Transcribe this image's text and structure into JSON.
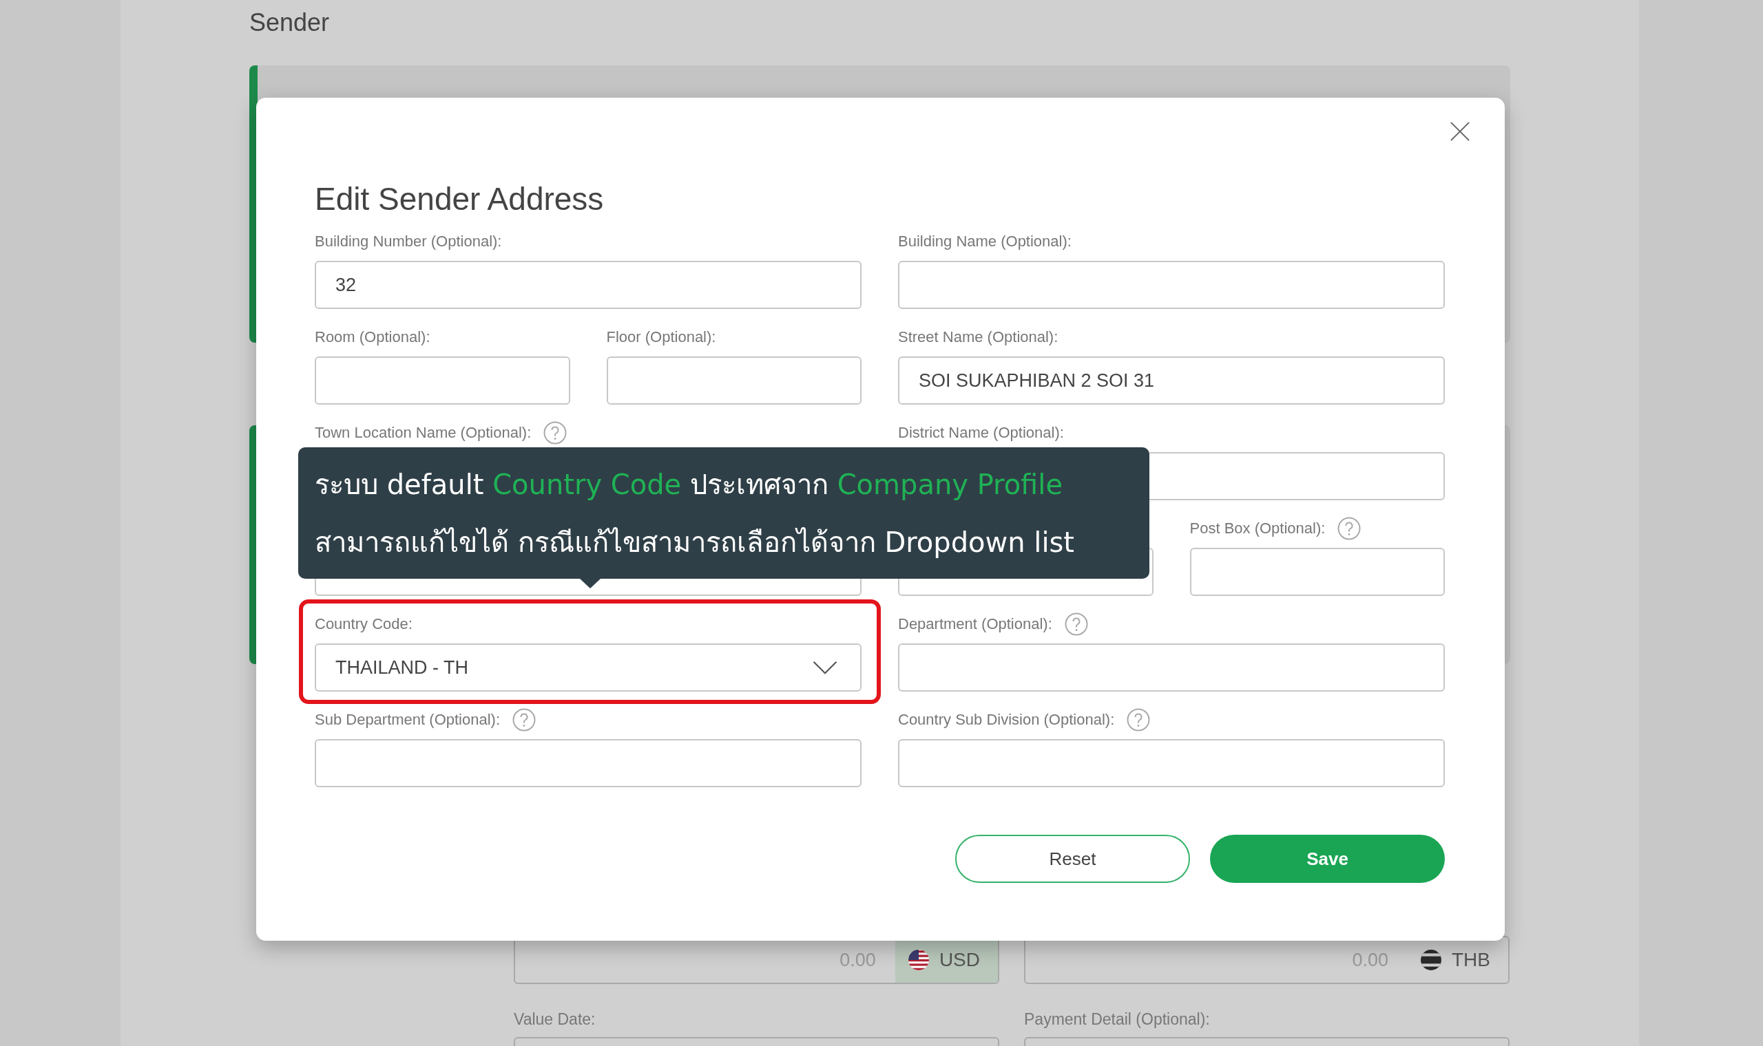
{
  "background": {
    "title": "Sender",
    "amounts": [
      {
        "value": "0.00",
        "currency": "USD",
        "kind": "usd"
      },
      {
        "value": "0.00",
        "currency": "THB",
        "kind": "thb"
      }
    ],
    "labels": [
      "Value Date:",
      "Payment Detail (Optional):"
    ]
  },
  "dialog": {
    "title": "Edit Sender Address",
    "fields": [
      {
        "kind": "wide",
        "label": "Building Number (Optional):",
        "value": "32"
      },
      {
        "kind": "wide",
        "label": "Building Name (Optional):"
      },
      {
        "kind": "narrow",
        "label": "Room (Optional):"
      },
      {
        "kind": "narrow",
        "label": "Floor (Optional):"
      },
      {
        "kind": "wide",
        "label": "Street Name (Optional):",
        "value": "SOI SUKAPHIBAN 2 SOI 31"
      },
      {
        "kind": "wide",
        "label": "Town Location Name (Optional):",
        "help": true
      },
      {
        "kind": "wide",
        "label": "District Name (Optional):"
      },
      {
        "kind": "wide"
      },
      {
        "kind": "narrow"
      },
      {
        "kind": "narrow",
        "label": "Post Box (Optional):",
        "help": true
      },
      {
        "kind": "select",
        "label": "Country Code:",
        "value": "THAILAND - TH",
        "highlighted": true
      },
      {
        "kind": "wide",
        "label": "Department (Optional):",
        "help": true
      },
      {
        "kind": "wide",
        "label": "Sub Department (Optional):",
        "help": true
      },
      {
        "kind": "wide",
        "label": "Country Sub Division (Optional):",
        "help": true
      }
    ],
    "buttons": [
      {
        "label": "Reset",
        "kind": "secondary"
      },
      {
        "label": "Save",
        "kind": "primary"
      }
    ]
  },
  "tooltip": {
    "lines": [
      [
        {
          "text": "ระบบ default ",
          "highlight": false
        },
        {
          "text": "Country Code",
          "highlight": true
        },
        {
          "text": " ประเทศจาก ",
          "highlight": false
        },
        {
          "text": "Company Profile",
          "highlight": true
        }
      ],
      [
        {
          "text": "สามารถแก้ไขได้ กรณีแก้ไขสามารถเลือกได้จาก Dropdown list",
          "highlight": false
        }
      ]
    ]
  }
}
